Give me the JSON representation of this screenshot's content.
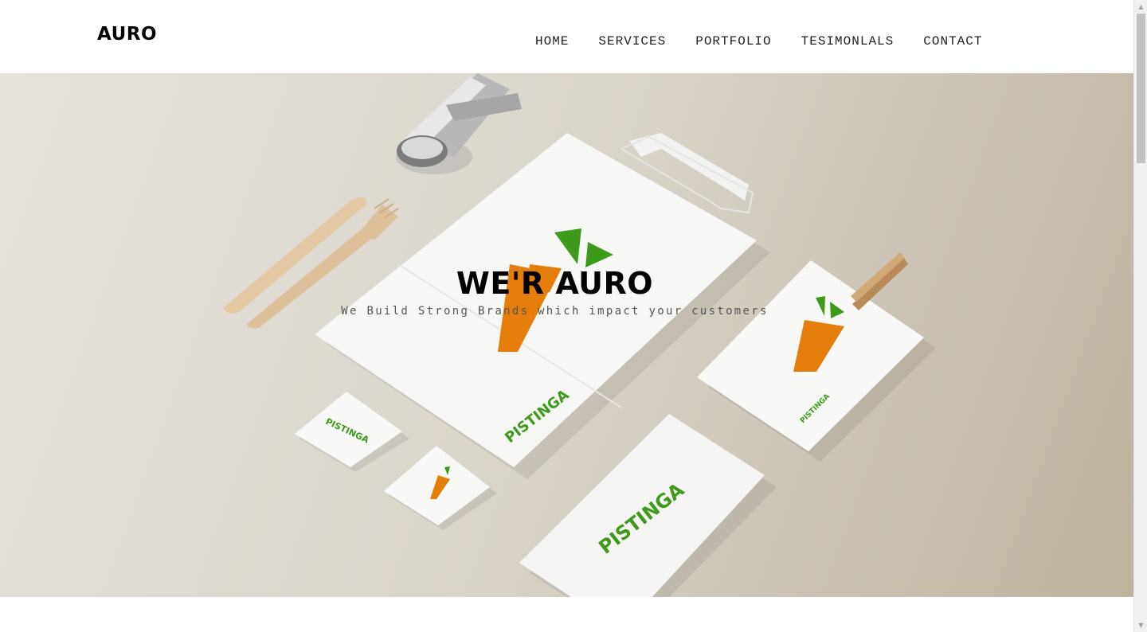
{
  "header": {
    "brand": "AURO",
    "nav": [
      "HOME",
      "SERVICES",
      "PORTFOLIO",
      "TESIMONLALS",
      "CONTACT"
    ]
  },
  "hero": {
    "title": "WE'R AURO",
    "subtitle": "We Build Strong Brands which impact your customers",
    "image_text": {
      "bag_logo": "PISTINGA",
      "sachet_logo": "PISTINGA",
      "napkin_logo": "PISTINGA",
      "pouch_logo": "PISTINGA"
    }
  },
  "colors": {
    "brand_green": "#3e9a1a",
    "brand_orange": "#e57d0b",
    "background": "#ffffff",
    "nav_text": "#222222"
  }
}
